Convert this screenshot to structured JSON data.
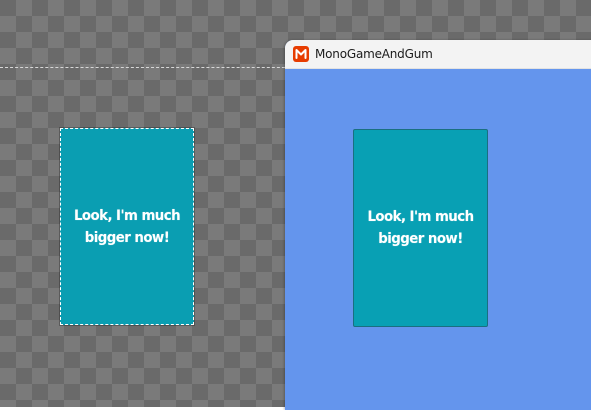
{
  "editor": {
    "card_text": "Look, I'm much bigger now!"
  },
  "game_window": {
    "title": "MonoGameAndGum",
    "icon": "monogame-logo-icon",
    "background_color": "#6495ed",
    "card_text": "Look, I'm much bigger now!"
  },
  "colors": {
    "card_fill": "#0a9eb2",
    "monogame_brand": "#e73c00"
  }
}
